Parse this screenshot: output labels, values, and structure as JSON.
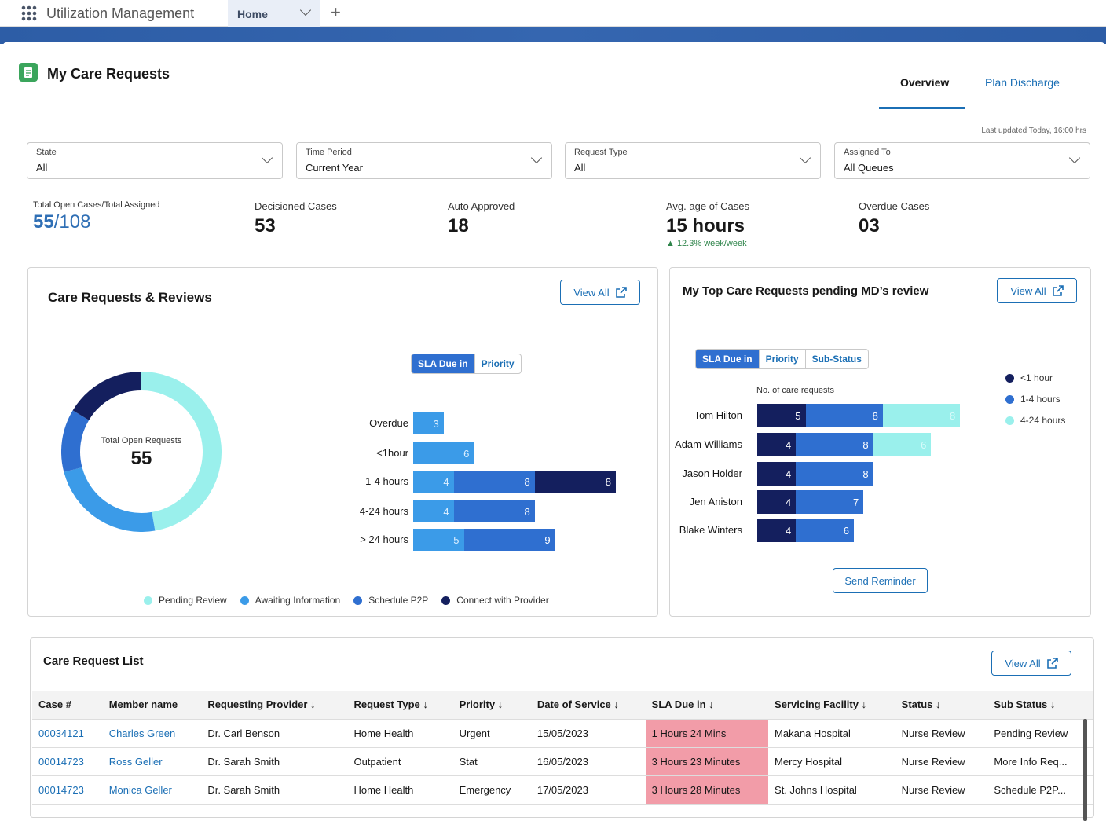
{
  "app": {
    "title": "Utilization Management",
    "tab": "Home",
    "new_tab": "+"
  },
  "header": {
    "title": "My Care Requests",
    "tabs": [
      {
        "label": "Overview",
        "active": true
      },
      {
        "label": "Plan Discharge"
      }
    ],
    "last_updated": "Last updated Today, 16:00 hrs"
  },
  "filters": [
    {
      "label": "State",
      "value": "All"
    },
    {
      "label": "Time Period",
      "value": "Current Year"
    },
    {
      "label": "Request Type",
      "value": "All"
    },
    {
      "label": "Assigned To",
      "value": "All Queues"
    }
  ],
  "kpis": {
    "open": {
      "label": "Total Open Cases/Total Assigned",
      "open": "55",
      "sep": "/",
      "total": "108"
    },
    "decisioned": {
      "label": "Decisioned Cases",
      "value": "53"
    },
    "auto": {
      "label": "Auto Approved",
      "value": "18"
    },
    "age": {
      "label": "Avg. age of Cases",
      "value": "15 hours",
      "trend": "▲ 12.3% week/week"
    },
    "overdue": {
      "label": "Overdue Cases",
      "value": "03"
    }
  },
  "colors": {
    "pending": "#9af0ec",
    "awaiting": "#3b9be8",
    "p2p": "#2f6fd0",
    "connect": "#141f5e",
    "accent": "#1b6fb5",
    "sla_highlight": "#f29ca8"
  },
  "reviews": {
    "title": "Care Requests & Reviews",
    "view_all": "View All",
    "toggle": [
      "SLA Due in",
      "Priority"
    ],
    "donut_label": "Total Open Requests",
    "donut_value": "55"
  },
  "pending_md": {
    "title": "My Top Care Requests pending MD’s review",
    "view_all": "View All",
    "toggle": [
      "SLA Due in",
      "Priority",
      "Sub-Status"
    ],
    "axis_label": "No. of care requests",
    "send_reminder": "Send Reminder"
  },
  "chart_data": [
    {
      "type": "pie",
      "variant": "donut",
      "categories": [
        "Pending Review",
        "Awaiting Information",
        "Schedule P2P",
        "Connect with Provider"
      ],
      "values": [
        26,
        13,
        7,
        9
      ],
      "legend": "bottom"
    },
    {
      "type": "bar",
      "orientation": "horizontal",
      "stacked": true,
      "categories": [
        "Overdue",
        "<1hour",
        "1-4 hours",
        "4-24 hours",
        "> 24 hours"
      ],
      "series": [
        {
          "name": "Awaiting Information",
          "values": [
            3,
            6,
            4,
            4,
            5
          ]
        },
        {
          "name": "Schedule P2P",
          "values": [
            0,
            0,
            8,
            8,
            9
          ]
        },
        {
          "name": "Connect with Provider",
          "values": [
            0,
            0,
            8,
            0,
            0
          ]
        }
      ]
    },
    {
      "type": "bar",
      "orientation": "horizontal",
      "stacked": true,
      "categories": [
        "Tom Hilton",
        "Adam Williams",
        "Jason Holder",
        "Jen Aniston",
        "Blake Winters"
      ],
      "xlabel": "No. of care requests",
      "legend": "right",
      "series": [
        {
          "name": "<1 hour",
          "values": [
            5,
            4,
            4,
            4,
            4
          ]
        },
        {
          "name": "1-4 hours",
          "values": [
            8,
            8,
            8,
            7,
            6
          ]
        },
        {
          "name": "4-24 hours",
          "values": [
            8,
            6,
            0,
            0,
            0
          ]
        }
      ]
    }
  ],
  "list": {
    "title": "Care Request List",
    "view_all": "View All",
    "columns": [
      "Case #",
      "Member name",
      "Requesting Provider ↓",
      "Request Type ↓",
      "Priority ↓",
      "Date of Service ↓",
      "SLA Due in ↓",
      "Servicing Facility ↓",
      "Status ↓",
      "Sub Status ↓"
    ],
    "rows": [
      [
        "00034121",
        "Charles Green",
        "Dr. Carl Benson",
        "Home Health",
        "Urgent",
        "15/05/2023",
        "1 Hours 24 Mins",
        "Makana Hospital",
        "Nurse Review",
        "Pending Review"
      ],
      [
        "00014723",
        "Ross Geller",
        "Dr. Sarah Smith",
        "Outpatient",
        "Stat",
        "16/05/2023",
        "3 Hours 23 Minutes",
        "Mercy Hospital",
        "Nurse Review",
        "More Info Req..."
      ],
      [
        "00014723",
        "Monica Geller",
        "Dr. Sarah Smith",
        "Home Health",
        "Emergency",
        "17/05/2023",
        "3 Hours 28 Minutes",
        "St. Johns Hospital",
        "Nurse Review",
        "Schedule P2P..."
      ]
    ]
  }
}
